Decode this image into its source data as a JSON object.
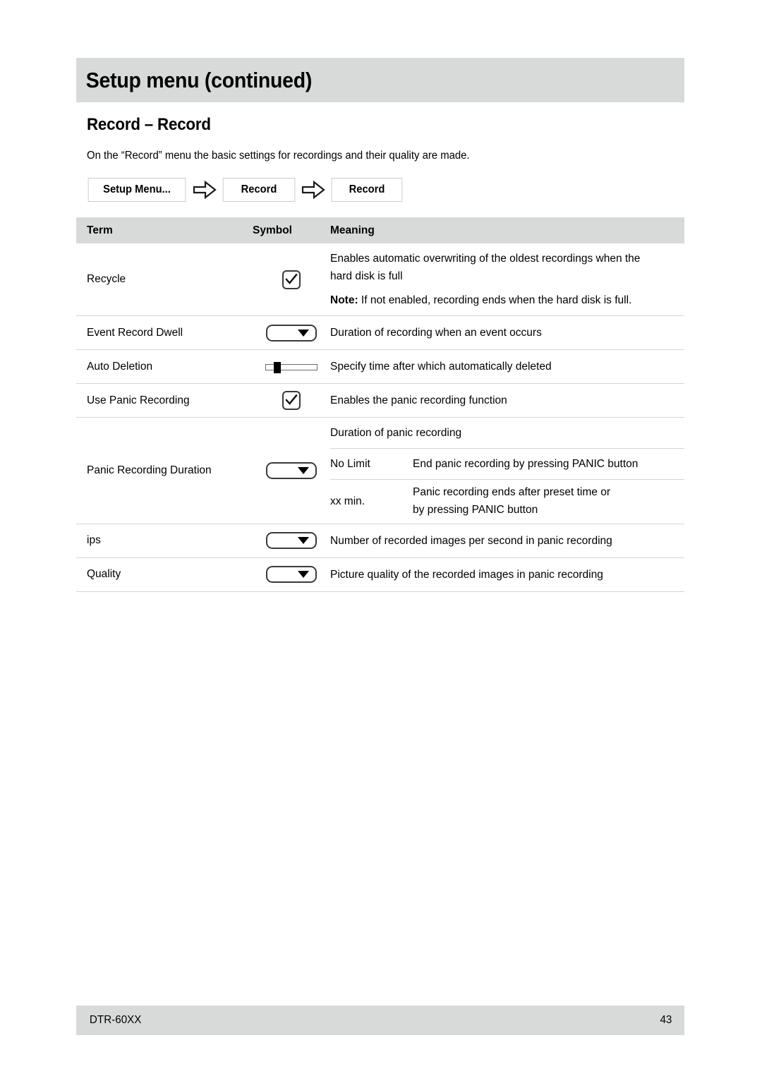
{
  "header": {
    "title": "Setup menu (continued)"
  },
  "section": {
    "heading": "Record – Record",
    "intro": "On the “Record” menu the basic settings for recordings and their quality are made."
  },
  "breadcrumb": {
    "items": [
      {
        "label": "Setup Menu..."
      },
      {
        "label": "Record"
      },
      {
        "label": "Record"
      }
    ],
    "separator_icon": "arrow-right-outline-icon"
  },
  "table": {
    "columns": {
      "term": "Term",
      "symbol": "Symbol",
      "meaning": "Meaning"
    },
    "rows": [
      {
        "term": "Recycle",
        "symbol": "checkbox-checked-icon",
        "meaning_line1": "Enables automatic overwriting of the oldest recordings when the",
        "meaning_line2": "hard disk is full",
        "note_label": "Note:",
        "note_text": " If not enabled, recording ends when the hard disk is full."
      },
      {
        "term": "Event Record Dwell",
        "symbol": "dropdown-icon",
        "meaning": "Duration of recording when an event occurs"
      },
      {
        "term": "Auto Deletion",
        "symbol": "slider-icon",
        "meaning": "Specify time after which automatically deleted"
      },
      {
        "term": "Use Panic Recording",
        "symbol": "checkbox-checked-icon",
        "meaning": "Enables the panic recording function"
      },
      {
        "term": "Panic Recording Duration",
        "symbol": "dropdown-icon",
        "sub_rows": [
          {
            "key": "",
            "value_line1": "Duration of panic recording",
            "value_line2": ""
          },
          {
            "key": "No Limit",
            "value_line1": "End panic recording by pressing PANIC button",
            "value_line2": ""
          },
          {
            "key": "xx min.",
            "value_line1": "Panic recording ends after preset time or",
            "value_line2": "by pressing PANIC button"
          }
        ]
      },
      {
        "term": "ips",
        "symbol": "dropdown-icon",
        "meaning": "Number of recorded images per second in panic recording"
      },
      {
        "term": "Quality",
        "symbol": "dropdown-icon",
        "meaning": "Picture quality of the recorded images in panic recording"
      }
    ]
  },
  "footer": {
    "model": "DTR-60XX",
    "page_number": "43"
  },
  "colors": {
    "band_gray": "#d8dada",
    "rule_gray": "#d3d6d7",
    "box_border": "#c9cccd"
  }
}
